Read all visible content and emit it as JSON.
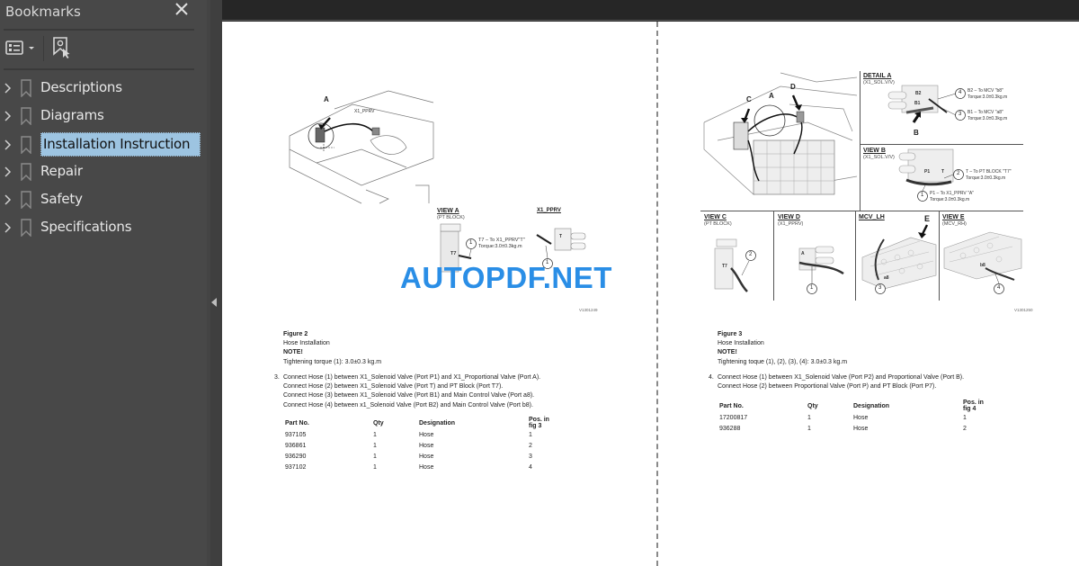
{
  "sidebar": {
    "title": "Bookmarks",
    "close_icon": "close-icon",
    "toolbar": {
      "options_icon": "list-options-icon",
      "new_bookmark_icon": "new-bookmark-icon"
    },
    "items": [
      {
        "label": "Descriptions",
        "selected": false
      },
      {
        "label": "Diagrams",
        "selected": false
      },
      {
        "label": "Installation Instruction",
        "selected": true
      },
      {
        "label": "Repair",
        "selected": false
      },
      {
        "label": "Safety",
        "selected": false
      },
      {
        "label": "Specifications",
        "selected": false
      }
    ],
    "selected_color": "#9dc4e1"
  },
  "watermark": "AUTOPDF.NET",
  "watermark_color": "#2a8ee6",
  "left_page": {
    "figure": {
      "callout_A": "A",
      "label_x1pprv_top": "X1_PPRV",
      "view_a_title": "VIEW A",
      "view_a_sub": "(PT BLOCK)",
      "view_a_port": "T7",
      "view_a_callout_num": "1",
      "view_a_callout_line1": "T7 – To X1_PPRV\"T\"",
      "view_a_callout_line2": "Torque:3.0±0.3kg.m",
      "x1pprv_title": "X1_PPRV",
      "x1pprv_port": "T",
      "x1pprv_callout_num": "1",
      "code": "V1301249"
    },
    "caption": {
      "figure": "Figure 2",
      "title": "Hose Installation",
      "note": "NOTE!",
      "torque": "Tightening torque (1): 3.0±0.3 kg.m"
    },
    "step": {
      "number": "3.",
      "lines": [
        "Connect Hose (1) between X1_Solenoid Valve (Port P1) and X1_Proportional Valve (Port A).",
        "Connect Hose (2) between X1_Solenoid Valve (Port T) and PT Block (Port T7).",
        "Connect Hose (3) between X1_Solenoid Valve (Port B1) and Main Control Valve (Port a8).",
        "Connect Hose (4) between x1_Solenoid Valve (Port B2) and Main Control Valve (Port b8)."
      ]
    },
    "table": {
      "headers": [
        "Part No.",
        "Qty",
        "Designation",
        "Pos. in fig 3"
      ],
      "rows": [
        [
          "937105",
          "1",
          "Hose",
          "1"
        ],
        [
          "936861",
          "1",
          "Hose",
          "2"
        ],
        [
          "936290",
          "1",
          "Hose",
          "3"
        ],
        [
          "937102",
          "1",
          "Hose",
          "4"
        ]
      ]
    }
  },
  "right_page": {
    "figure": {
      "callout_A": "A",
      "callout_C": "C",
      "callout_D": "D",
      "detail_a_title": "DETAIL A",
      "detail_a_sub": "(X1_SOL.V/V)",
      "detail_a_port_b2": "B2",
      "detail_a_port_b1": "B1",
      "detail_a_callouts": [
        {
          "num": "4",
          "line1": "B2 – To MCV \"b8\"",
          "line2": "Torque:3.0±0.3kg.m"
        },
        {
          "num": "3",
          "line1": "B1 – To MCV \"a8\"",
          "line2": "Torque:3.0±0.3kg.m"
        }
      ],
      "detail_a_arrow": "B",
      "view_b_title": "VIEW B",
      "view_b_sub": "(X1_SOL.V/V)",
      "view_b_ports": [
        "P1",
        "T"
      ],
      "view_b_callouts": [
        {
          "num": "2",
          "line1": "T – To PT BLOCK \"T7\"",
          "line2": "Torque:3.0±0.3kg.m"
        },
        {
          "num": "1",
          "line1": "P1 – To X1_PPRV \"A\"",
          "line2": "Torque:3.0±0.3kg.m"
        }
      ],
      "view_c_title": "VIEW C",
      "view_c_sub": "(PT BLOCK)",
      "view_c_port": "T7",
      "view_c_num": "2",
      "view_d_title": "VIEW D",
      "view_d_sub": "(X1_PPRV)",
      "view_d_port": "A",
      "view_d_num": "1",
      "mcv_lh_title": "MCV_LH",
      "mcv_lh_arrow": "E",
      "mcv_lh_port": "a8",
      "mcv_lh_num": "3",
      "view_e_title": "VIEW E",
      "view_e_sub": "(MCV_RH)",
      "view_e_port": "b8",
      "view_e_num": "4",
      "code": "V1301250"
    },
    "caption": {
      "figure": "Figure 3",
      "title": "Hose Installation",
      "note": "NOTE!",
      "torque": "Tightening toque (1), (2), (3), (4): 3.0±0.3 kg.m"
    },
    "step": {
      "number": "4.",
      "lines": [
        "Connect Hose (1) between X1_Solenoid Valve (Port P2) and Proportional Valve (Port B).",
        "Connect Hose (2) between Proportional Valve (Port P) and PT Block (Port P7)."
      ]
    },
    "table": {
      "headers": [
        "Part No.",
        "Qty",
        "Designation",
        "Pos. in fig 4"
      ],
      "rows": [
        [
          "17200817",
          "1",
          "Hose",
          "1"
        ],
        [
          "936288",
          "1",
          "Hose",
          "2"
        ]
      ]
    }
  }
}
